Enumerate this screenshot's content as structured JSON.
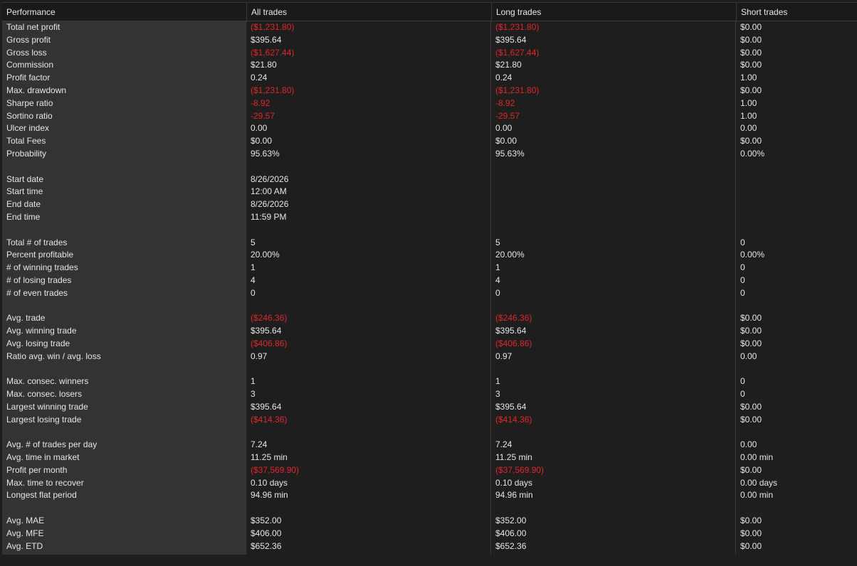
{
  "header": {
    "col0": "Performance",
    "col1": "All trades",
    "col2": "Long trades",
    "col3": "Short trades"
  },
  "rows": [
    {
      "label": "Total net profit",
      "all": "($1,231.80)",
      "long": "($1,231.80)",
      "short": "$0.00"
    },
    {
      "label": "Gross profit",
      "all": "$395.64",
      "long": "$395.64",
      "short": "$0.00"
    },
    {
      "label": "Gross loss",
      "all": "($1,627.44)",
      "long": "($1,627.44)",
      "short": "$0.00"
    },
    {
      "label": "Commission",
      "all": "$21.80",
      "long": "$21.80",
      "short": "$0.00"
    },
    {
      "label": "Profit factor",
      "all": "0.24",
      "long": "0.24",
      "short": "1.00"
    },
    {
      "label": "Max. drawdown",
      "all": "($1,231.80)",
      "long": "($1,231.80)",
      "short": "$0.00"
    },
    {
      "label": "Sharpe ratio",
      "all": "-8.92",
      "long": "-8.92",
      "short": "1.00"
    },
    {
      "label": "Sortino ratio",
      "all": "-29.57",
      "long": "-29.57",
      "short": "1.00"
    },
    {
      "label": "Ulcer index",
      "all": "0.00",
      "long": "0.00",
      "short": "0.00"
    },
    {
      "label": "Total Fees",
      "all": "$0.00",
      "long": "$0.00",
      "short": "$0.00"
    },
    {
      "label": "Probability",
      "all": "95.63%",
      "long": "95.63%",
      "short": "0.00%"
    },
    {
      "label": "",
      "all": "",
      "long": "",
      "short": ""
    },
    {
      "label": "Start date",
      "all": "8/26/2026",
      "long": "",
      "short": ""
    },
    {
      "label": "Start time",
      "all": "12:00 AM",
      "long": "",
      "short": ""
    },
    {
      "label": "End date",
      "all": "8/26/2026",
      "long": "",
      "short": ""
    },
    {
      "label": "End time",
      "all": "11:59 PM",
      "long": "",
      "short": ""
    },
    {
      "label": "",
      "all": "",
      "long": "",
      "short": ""
    },
    {
      "label": "Total # of trades",
      "all": "5",
      "long": "5",
      "short": "0"
    },
    {
      "label": "Percent profitable",
      "all": "20.00%",
      "long": "20.00%",
      "short": "0.00%"
    },
    {
      "label": "# of winning trades",
      "all": "1",
      "long": "1",
      "short": "0"
    },
    {
      "label": "# of losing trades",
      "all": "4",
      "long": "4",
      "short": "0"
    },
    {
      "label": "# of even trades",
      "all": "0",
      "long": "0",
      "short": "0"
    },
    {
      "label": "",
      "all": "",
      "long": "",
      "short": ""
    },
    {
      "label": "Avg. trade",
      "all": "($246.36)",
      "long": "($246.36)",
      "short": "$0.00"
    },
    {
      "label": "Avg. winning trade",
      "all": "$395.64",
      "long": "$395.64",
      "short": "$0.00"
    },
    {
      "label": "Avg. losing trade",
      "all": "($406.86)",
      "long": "($406.86)",
      "short": "$0.00"
    },
    {
      "label": "Ratio avg. win / avg. loss",
      "all": "0.97",
      "long": "0.97",
      "short": "0.00"
    },
    {
      "label": "",
      "all": "",
      "long": "",
      "short": ""
    },
    {
      "label": "Max. consec. winners",
      "all": "1",
      "long": "1",
      "short": "0"
    },
    {
      "label": "Max. consec. losers",
      "all": "3",
      "long": "3",
      "short": "0"
    },
    {
      "label": "Largest winning trade",
      "all": "$395.64",
      "long": "$395.64",
      "short": "$0.00"
    },
    {
      "label": "Largest losing trade",
      "all": "($414.36)",
      "long": "($414.36)",
      "short": "$0.00"
    },
    {
      "label": "",
      "all": "",
      "long": "",
      "short": ""
    },
    {
      "label": "Avg. # of trades per day",
      "all": "7.24",
      "long": "7.24",
      "short": "0.00"
    },
    {
      "label": "Avg. time in market",
      "all": "11.25 min",
      "long": "11.25 min",
      "short": "0.00 min"
    },
    {
      "label": "Profit per month",
      "all": "($37,569.90)",
      "long": "($37,569.90)",
      "short": "$0.00"
    },
    {
      "label": "Max. time to recover",
      "all": "0.10 days",
      "long": "0.10 days",
      "short": "0.00 days"
    },
    {
      "label": "Longest flat period",
      "all": "94.96 min",
      "long": "94.96 min",
      "short": "0.00 min"
    },
    {
      "label": "",
      "all": "",
      "long": "",
      "short": ""
    },
    {
      "label": "Avg. MAE",
      "all": "$352.00",
      "long": "$352.00",
      "short": "$0.00"
    },
    {
      "label": "Avg. MFE",
      "all": "$406.00",
      "long": "$406.00",
      "short": "$0.00"
    },
    {
      "label": "Avg. ETD",
      "all": "$652.36",
      "long": "$652.36",
      "short": "$0.00"
    }
  ],
  "colors": {
    "negative": "#e0272b",
    "text": "#e6e6e6",
    "label_column_bg": "#333333",
    "background": "#1e1e1e"
  }
}
